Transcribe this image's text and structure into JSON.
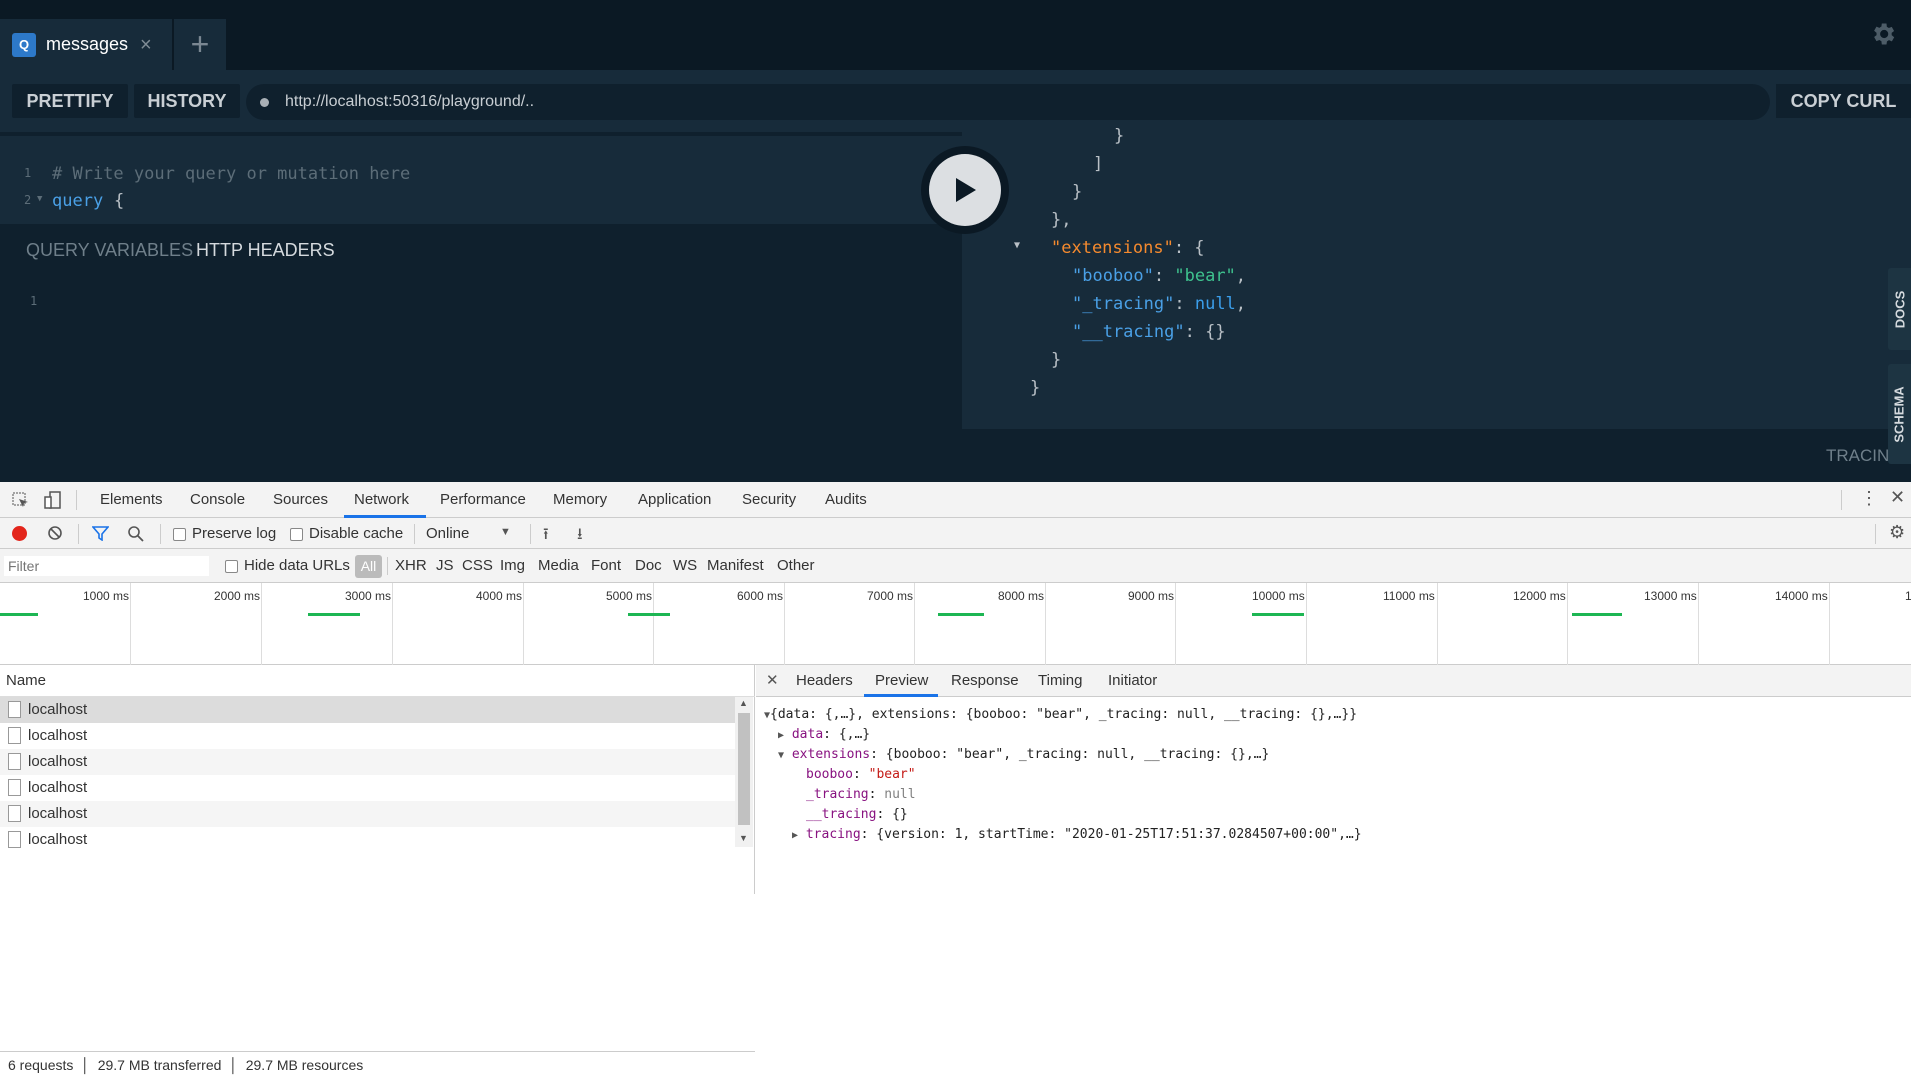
{
  "tabs": {
    "icon_letter": "Q",
    "name": "messages",
    "close": "×",
    "add": "+"
  },
  "toolbar": {
    "prettify": "PRETTIFY",
    "history": "HISTORY",
    "url": "http://localhost:50316/playground/..",
    "copy_curl": "COPY CURL"
  },
  "editor": {
    "lines": [
      "1",
      "2"
    ],
    "comment": "# Write your query or mutation here",
    "query_kw": "query",
    "brace": "{",
    "query_variables": "QUERY VARIABLES",
    "http_headers": "HTTP HEADERS",
    "var_line": "1"
  },
  "result": {
    "l1": "}",
    "l2": "]",
    "l3": "}",
    "l4": "},",
    "ext_key": "\"extensions\"",
    "ext_open": ": {",
    "booboo_key": "\"booboo\"",
    "booboo_val": "\"bear\"",
    "tracing_key": "\"_tracing\"",
    "tracing_val": "null",
    "tracing2_key": "\"__tracing\"",
    "tracing2_val": "{}",
    "close1": "}",
    "close2": "}"
  },
  "side": {
    "docs": "DOCS",
    "schema": "SCHEMA",
    "tracing": "TRACIN"
  },
  "devtools": {
    "tabs": [
      "Elements",
      "Console",
      "Sources",
      "Network",
      "Performance",
      "Memory",
      "Application",
      "Security",
      "Audits"
    ],
    "preserve_log": "Preserve log",
    "disable_cache": "Disable cache",
    "throttle": "Online",
    "filter_placeholder": "Filter",
    "hide_data_urls": "Hide data URLs",
    "types": [
      "All",
      "XHR",
      "JS",
      "CSS",
      "Img",
      "Media",
      "Font",
      "Doc",
      "WS",
      "Manifest",
      "Other"
    ],
    "ticks": [
      "1000 ms",
      "2000 ms",
      "3000 ms",
      "4000 ms",
      "5000 ms",
      "6000 ms",
      "7000 ms",
      "8000 ms",
      "9000 ms",
      "10000 ms",
      "11000 ms",
      "12000 ms",
      "13000 ms",
      "14000 ms",
      "1"
    ],
    "name_header": "Name",
    "rows": [
      "localhost",
      "localhost",
      "localhost",
      "localhost",
      "localhost",
      "localhost"
    ],
    "status": [
      "6 requests",
      "29.7 MB transferred",
      "29.7 MB resources"
    ],
    "preview_tabs": [
      "Headers",
      "Preview",
      "Response",
      "Timing",
      "Initiator"
    ],
    "preview": {
      "root": "{data: {,…}, extensions: {booboo: \"bear\", _tracing: null, __tracing: {},…}}",
      "data_key": "data",
      "data_val": ": {,…}",
      "ext_key": "extensions",
      "ext_val": ": {booboo: \"bear\", _tracing: null, __tracing: {},…}",
      "booboo_key": "booboo",
      "booboo_val": "\"bear\"",
      "tr_key": "_tracing",
      "tr_val": "null",
      "tr2_key": "__tracing",
      "tr2_val": "{}",
      "tracing_key": "tracing",
      "tracing_val": ": {version: 1, startTime: \"2020-01-25T17:51:37.0284507+00:00\",…}"
    }
  }
}
